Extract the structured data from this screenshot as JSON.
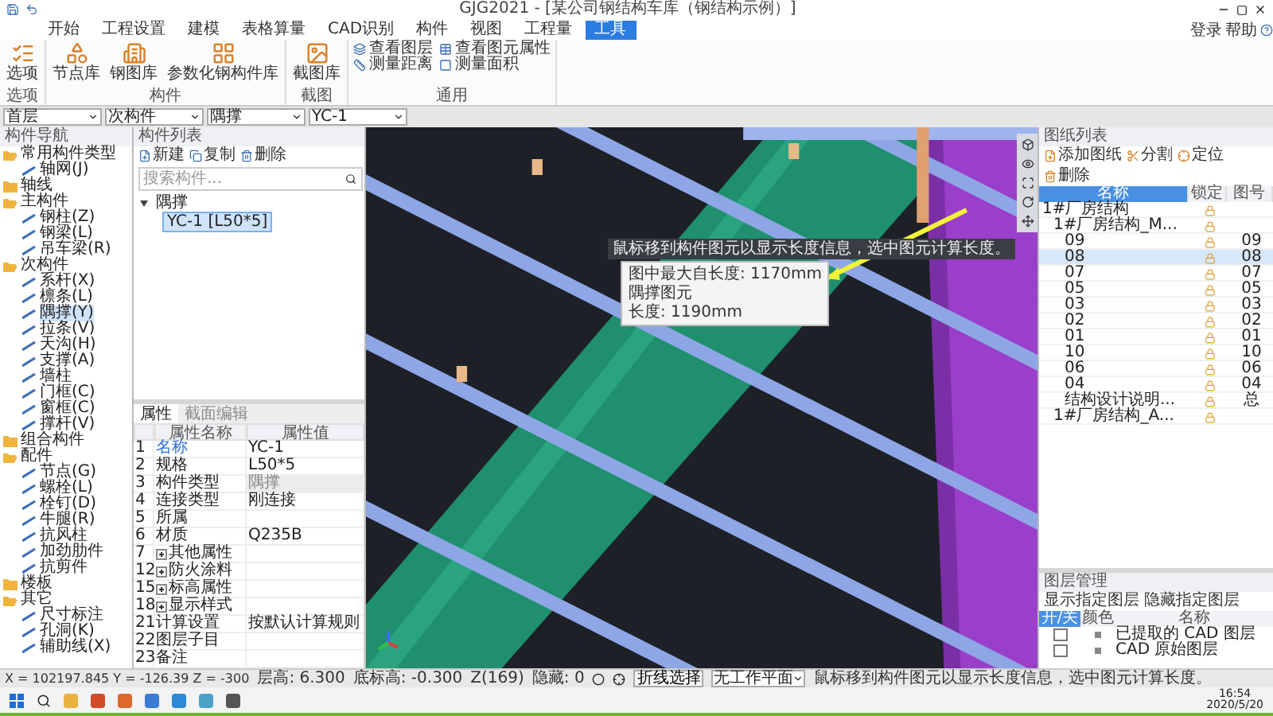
{
  "window": {
    "title": "GJG2021 - [某公司钢结构车库（钢结构示例）]"
  },
  "menu_tabs": [
    {
      "label": "开始",
      "selected": false
    },
    {
      "label": "工程设置",
      "selected": false
    },
    {
      "label": "建模",
      "selected": false
    },
    {
      "label": "表格算量",
      "selected": false
    },
    {
      "label": "CAD识别",
      "selected": false
    },
    {
      "label": "构件",
      "selected": false
    },
    {
      "label": "视图",
      "selected": false
    },
    {
      "label": "工程量",
      "selected": false
    },
    {
      "label": "工具",
      "selected": true
    }
  ],
  "account_links": [
    "登录",
    "帮助"
  ],
  "ribbon": [
    {
      "label": "选项",
      "buttons": [
        {
          "label": "选项",
          "kind": "large"
        }
      ]
    },
    {
      "label": "构件",
      "buttons": [
        {
          "label": "节点库",
          "kind": "large"
        },
        {
          "label": "钢图库",
          "kind": "large"
        },
        {
          "label": "参数化钢构件库",
          "kind": "large"
        }
      ]
    },
    {
      "label": "截图",
      "buttons": [
        {
          "label": "截图库",
          "kind": "large"
        }
      ]
    },
    {
      "label": "通用",
      "buttons": [
        {
          "label": "查看图层",
          "kind": "small"
        },
        {
          "label": "查看图元属性",
          "kind": "small"
        },
        {
          "label": "测量距离",
          "kind": "small"
        },
        {
          "label": "测量面积",
          "kind": "small"
        }
      ]
    }
  ],
  "selectors": [
    "首层",
    "次构件",
    "隅撑",
    "YC-1"
  ],
  "nav": {
    "title": "构件导航",
    "items": [
      {
        "label": "常用构件类型",
        "expanded": true,
        "children": [
          {
            "label": "轴网(J)",
            "selected": false
          }
        ]
      },
      {
        "label": "轴线",
        "expanded": false
      },
      {
        "label": "主构件",
        "expanded": true,
        "children": [
          {
            "label": "钢柱(Z)",
            "selected": false
          },
          {
            "label": "钢梁(L)",
            "selected": false
          },
          {
            "label": "吊车梁(R)",
            "selected": false
          }
        ]
      },
      {
        "label": "次构件",
        "expanded": true,
        "children": [
          {
            "label": "系杆(X)",
            "selected": false
          },
          {
            "label": "檩条(L)",
            "selected": false
          },
          {
            "label": "隅撑(Y)",
            "selected": true
          },
          {
            "label": "拉条(V)",
            "selected": false
          },
          {
            "label": "天沟(H)",
            "selected": false
          },
          {
            "label": "支撑(A)",
            "selected": false
          },
          {
            "label": "墙柱",
            "selected": false
          },
          {
            "label": "门框(C)",
            "selected": false
          },
          {
            "label": "窗框(C)",
            "selected": false
          },
          {
            "label": "撑杆(V)",
            "selected": false
          }
        ]
      },
      {
        "label": "组合构件",
        "expanded": false
      },
      {
        "label": "配件",
        "expanded": true,
        "children": [
          {
            "label": "节点(G)",
            "selected": false
          },
          {
            "label": "螺栓(L)",
            "selected": false
          },
          {
            "label": "栓钉(D)",
            "selected": false
          },
          {
            "label": "牛腿(R)",
            "selected": false
          },
          {
            "label": "抗风柱",
            "selected": false
          },
          {
            "label": "加劲肋件",
            "selected": false
          },
          {
            "label": "抗剪件",
            "selected": false
          }
        ]
      },
      {
        "label": "楼板",
        "expanded": false
      },
      {
        "label": "其它",
        "expanded": true,
        "children": [
          {
            "label": "尺寸标注",
            "selected": false
          },
          {
            "label": "孔洞(K)",
            "selected": false
          },
          {
            "label": "辅助线(X)",
            "selected": false
          }
        ]
      }
    ]
  },
  "component_list": {
    "title": "构件列表",
    "tools": [
      "新建",
      "复制",
      "删除"
    ],
    "search": {
      "placeholder": "搜索构件..."
    },
    "tree": [
      {
        "label": "隅撑",
        "expanded": true,
        "children": [
          {
            "label": "YC-1 [L50*5]",
            "selected": true
          }
        ]
      }
    ]
  },
  "properties": {
    "tabs": [
      {
        "label": "属性",
        "selected": true
      },
      {
        "label": "截面编辑",
        "selected": false
      }
    ],
    "columns": [
      "属性名称",
      "属性值"
    ],
    "rows": [
      {
        "no": "1",
        "name": "名称",
        "value": "YC-1",
        "kind": "plain"
      },
      {
        "no": "2",
        "name": "规格",
        "value": "L50*5",
        "kind": "plain"
      },
      {
        "no": "3",
        "name": "构件类型",
        "value": "隅撑",
        "kind": "readonly"
      },
      {
        "no": "4",
        "name": "连接类型",
        "value": "刚连接",
        "kind": "plain"
      },
      {
        "no": "5",
        "name": "所属",
        "kind": "plain"
      },
      {
        "no": "6",
        "name": "材质",
        "value": "Q235B",
        "kind": "plain"
      },
      {
        "no": "7",
        "name": "其他属性",
        "kind": "group"
      },
      {
        "no": "12",
        "name": "防火涂料",
        "kind": "group"
      },
      {
        "no": "15",
        "name": "标高属性",
        "kind": "group"
      },
      {
        "no": "18",
        "name": "显示样式",
        "kind": "group"
      },
      {
        "no": "21",
        "name": "计算设置",
        "value": "按默认计算规则",
        "kind": "plain"
      },
      {
        "no": "22",
        "name": "图层子目",
        "kind": "plain"
      },
      {
        "no": "23",
        "name": "备注",
        "kind": "plain"
      }
    ]
  },
  "viewport": {
    "hint": "鼠标移到构件图元以显示长度信息，选中图元计算长度。",
    "info": [
      "图中最大自长度: 1170mm",
      "隅撑图元",
      "长度: 1190mm"
    ]
  },
  "drawing_list": {
    "title": "图纸列表",
    "tools": [
      "添加图纸",
      "分割",
      "定位",
      "删除"
    ],
    "columns": [
      "名称",
      "锁定",
      "图号"
    ],
    "rows": [
      {
        "name": "1#厂房结构",
        "selected": false,
        "children": [
          {
            "name": "1#厂房结构_M...",
            "selected": false,
            "children": [
              {
                "name": "09",
                "number": "09",
                "selected": false
              },
              {
                "name": "08",
                "number": "08",
                "selected": true
              },
              {
                "name": "07",
                "number": "07",
                "selected": false
              },
              {
                "name": "05",
                "number": "05",
                "selected": false
              },
              {
                "name": "03",
                "number": "03",
                "selected": false
              },
              {
                "name": "02",
                "number": "02",
                "selected": false
              },
              {
                "name": "01",
                "number": "01",
                "selected": false
              },
              {
                "name": "10",
                "number": "10",
                "selected": false
              },
              {
                "name": "06",
                "number": "06",
                "selected": false
              },
              {
                "name": "04",
                "number": "04",
                "selected": false
              },
              {
                "name": "结构设计说明...",
                "number": "总",
                "selected": false
              }
            ]
          },
          {
            "name": "1#厂房结构_A...",
            "selected": false
          }
        ]
      }
    ]
  },
  "layers": {
    "title": "图层管理",
    "tools": [
      "显示指定图层",
      "隐藏指定图层"
    ],
    "columns": [
      "开/关",
      "颜色",
      "名称"
    ],
    "rows": [
      {
        "name": "已提取的 CAD 图层",
        "on": false
      },
      {
        "name": "CAD 原始图层",
        "on": false
      }
    ]
  },
  "status_bar": {
    "coords": "X = 102197.845 Y = -126.39 Z = -300",
    "floor_height": "层高: 6.300",
    "base_elevation": "底标高: -0.300",
    "z_count": "Z(169)",
    "hidden": "隐藏: 0",
    "select_mode": "折线选择",
    "work_plane": "无工作平面",
    "message": "鼠标移到构件图元以显示长度信息，选中图元计算长度。"
  },
  "taskbar": {
    "time": "16:54",
    "date": "2020/5/20"
  }
}
